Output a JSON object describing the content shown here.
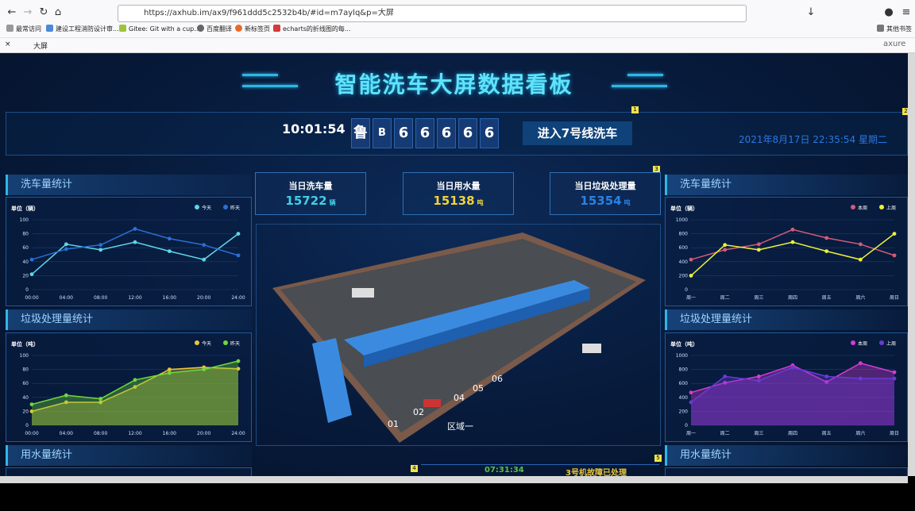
{
  "browser": {
    "url": "https://axhub.im/ax9/f961ddd5c2532b4b/#id=m7aylq&p=大屏",
    "bookmarks": [
      "最常访问",
      "建设工程消防设计审...",
      "Gitee: Git with a cup...",
      "百度翻译",
      "新标签页",
      "echarts的折线图的每..."
    ],
    "other_bookmarks": "其他书签",
    "tab_title": "大屏",
    "brand": "axure"
  },
  "screen": {
    "title": "智能洗车大屏数据看板",
    "clock": "10:01:54",
    "plate": [
      "鲁",
      "B",
      "6",
      "6",
      "6",
      "6",
      "6"
    ],
    "notice": "进入7号线洗车",
    "datetime": "2021年8月17日  22:35:54   星期二",
    "tags": [
      "1",
      "2",
      "3",
      "4",
      "5"
    ]
  },
  "stats": [
    {
      "label": "当日洗车量",
      "value": "15722",
      "unit": "辆",
      "color": "#3fd0e8"
    },
    {
      "label": "当日用水量",
      "value": "15138",
      "unit": "吨",
      "color": "#f2d23a"
    },
    {
      "label": "当日垃圾处理量",
      "value": "15354",
      "unit": "吨",
      "color": "#2a82e4"
    }
  ],
  "sections": {
    "left_top": "洗车量统计",
    "left_mid": "垃圾处理量统计",
    "left_bot": "用水量统计",
    "right_top": "洗车量统计",
    "right_mid": "垃圾处理量统计",
    "right_bot": "用水量统计"
  },
  "bottom_ticker": {
    "time": "07:31:34",
    "text": "3号机故障已处理"
  },
  "scene_labels": {
    "lanes": [
      "01",
      "02",
      "04",
      "05",
      "06"
    ],
    "zone": "区域一"
  },
  "chart_data": [
    {
      "type": "line",
      "unit": "单位（辆）",
      "categories": [
        "00:00",
        "04:00",
        "08:00",
        "12:00",
        "16:00",
        "20:00",
        "24:00"
      ],
      "ylim": [
        0,
        100
      ],
      "yticks": [
        0,
        20,
        40,
        60,
        80,
        100
      ],
      "series": [
        {
          "name": "今天",
          "color": "#5fd6e8",
          "values": [
            22,
            65,
            57,
            68,
            55,
            43,
            80
          ]
        },
        {
          "name": "昨天",
          "color": "#2a6fd6",
          "values": [
            43,
            58,
            64,
            87,
            73,
            64,
            49
          ]
        }
      ],
      "area": false
    },
    {
      "type": "area",
      "unit": "单位（吨）",
      "categories": [
        "00:00",
        "04:00",
        "08:00",
        "12:00",
        "16:00",
        "20:00",
        "24:00"
      ],
      "ylim": [
        0,
        100
      ],
      "yticks": [
        0,
        20,
        40,
        60,
        80,
        100
      ],
      "series": [
        {
          "name": "今天",
          "color": "#e8c53a",
          "values": [
            20,
            33,
            33,
            55,
            80,
            83,
            81
          ]
        },
        {
          "name": "昨天",
          "color": "#6fd83a",
          "values": [
            30,
            43,
            38,
            65,
            75,
            80,
            92
          ]
        }
      ],
      "area": true
    },
    {
      "type": "line",
      "unit": "单位（辆）",
      "categories": [
        "周一",
        "周二",
        "周三",
        "周四",
        "周五",
        "周六",
        "周日"
      ],
      "ylim": [
        0,
        1000
      ],
      "yticks": [
        0,
        200,
        400,
        600,
        800,
        1000
      ],
      "series": [
        {
          "name": "本周",
          "color": "#d65a78",
          "values": [
            430,
            570,
            650,
            860,
            740,
            650,
            490
          ]
        },
        {
          "name": "上周",
          "color": "#eef23a",
          "values": [
            200,
            640,
            570,
            680,
            550,
            430,
            800
          ]
        }
      ],
      "area": false
    },
    {
      "type": "area",
      "unit": "单位（吨）",
      "categories": [
        "周一",
        "周二",
        "周三",
        "周四",
        "周五",
        "周六",
        "周日"
      ],
      "ylim": [
        0,
        1000
      ],
      "yticks": [
        0,
        200,
        400,
        600,
        800,
        1000
      ],
      "series": [
        {
          "name": "本周",
          "color": "#d63ad6",
          "values": [
            470,
            610,
            700,
            860,
            620,
            890,
            760
          ]
        },
        {
          "name": "上周",
          "color": "#6a3ad6",
          "values": [
            330,
            700,
            640,
            830,
            700,
            670,
            670
          ]
        }
      ],
      "area": true
    }
  ]
}
